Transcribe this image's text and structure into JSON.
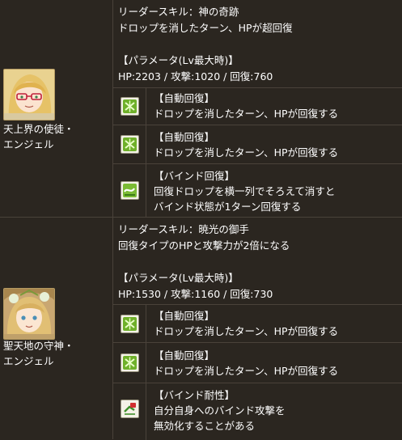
{
  "monsters": [
    {
      "name_line1": "天上界の使徒・",
      "name_line2": "エンジェル",
      "leader_label": "リーダースキル：神の奇跡",
      "leader_desc": "ドロップを消したターン、HPが超回復",
      "param_label": "【パラメータ(Lv最大時)】",
      "stats": "HP:2203 / 攻撃:1020 / 回復:760",
      "awakenings": [
        {
          "title": "【自動回復】",
          "line1": "ドロップを消したターン、HPが回復する",
          "line2": "",
          "icon": "auto-heal-icon"
        },
        {
          "title": "【自動回復】",
          "line1": "ドロップを消したターン、HPが回復する",
          "line2": "",
          "icon": "auto-heal-icon"
        },
        {
          "title": "【バインド回復】",
          "line1": "回復ドロップを横一列でそろえて消すと",
          "line2": "バインド状態が1ターン回復する",
          "icon": "bind-recovery-icon"
        }
      ]
    },
    {
      "name_line1": "聖天地の守神・",
      "name_line2": "エンジェル",
      "leader_label": "リーダースキル：暁光の御手",
      "leader_desc": "回復タイプのHPと攻撃力が2倍になる",
      "param_label": "【パラメータ(Lv最大時)】",
      "stats": "HP:1530 / 攻撃:1160 / 回復:730",
      "awakenings": [
        {
          "title": "【自動回復】",
          "line1": "ドロップを消したターン、HPが回復する",
          "line2": "",
          "icon": "auto-heal-icon"
        },
        {
          "title": "【自動回復】",
          "line1": "ドロップを消したターン、HPが回復する",
          "line2": "",
          "icon": "auto-heal-icon"
        },
        {
          "title": "【バインド耐性】",
          "line1": "自分自身へのバインド攻撃を",
          "line2": "無効化することがある",
          "icon": "bind-resist-icon"
        }
      ]
    }
  ]
}
